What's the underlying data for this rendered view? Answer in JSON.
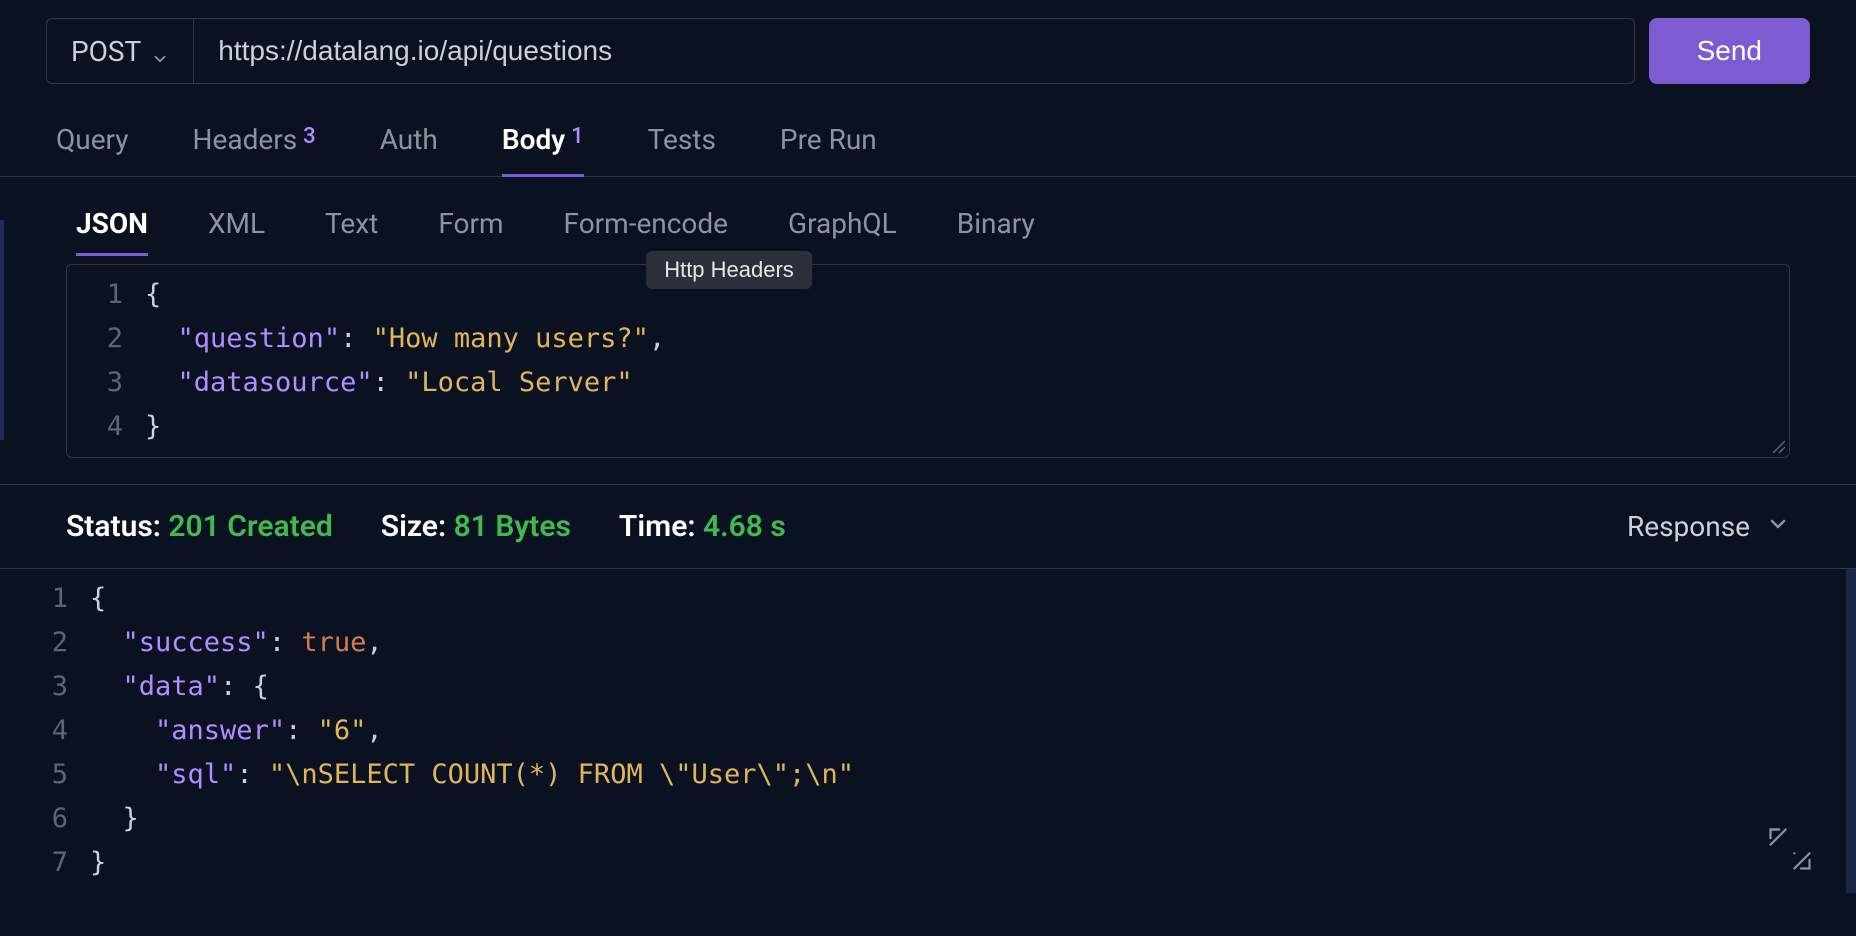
{
  "request": {
    "method": "POST",
    "url": "https://datalang.io/api/questions",
    "send_label": "Send"
  },
  "tabs": {
    "query": "Query",
    "headers": "Headers",
    "headers_badge": "3",
    "auth": "Auth",
    "body": "Body",
    "body_badge": "1",
    "tests": "Tests",
    "prerun": "Pre Run"
  },
  "subtabs": {
    "json": "JSON",
    "xml": "XML",
    "text": "Text",
    "form": "Form",
    "form_encode": "Form-encode",
    "graphql": "GraphQL",
    "binary": "Binary"
  },
  "tooltip": {
    "text": "Http Headers"
  },
  "request_body": {
    "line_numbers": [
      "1",
      "2",
      "3",
      "4"
    ],
    "lines": {
      "l1_punc": "{",
      "l2_key": "\"question\"",
      "l2_colon": ": ",
      "l2_val": "\"How many users?\"",
      "l2_comma": ",",
      "l3_key": "\"datasource\"",
      "l3_colon": ": ",
      "l3_val": "\"Local Server\"",
      "l4_punc": "}"
    }
  },
  "status": {
    "status_label": "Status: ",
    "status_value": "201 Created",
    "size_label": "Size: ",
    "size_value": "81 Bytes",
    "time_label": "Time: ",
    "time_value": "4.68 s",
    "response_label": "Response"
  },
  "response_body": {
    "line_numbers": [
      "1",
      "2",
      "3",
      "4",
      "5",
      "6",
      "7"
    ],
    "lines": {
      "l1": "{",
      "l2_key": "\"success\"",
      "l2_colon": ": ",
      "l2_val": "true",
      "l2_comma": ",",
      "l3_key": "\"data\"",
      "l3_colon": ": ",
      "l3_brace": "{",
      "l4_key": "\"answer\"",
      "l4_colon": ": ",
      "l4_val": "\"6\"",
      "l4_comma": ",",
      "l5_key": "\"sql\"",
      "l5_colon": ": ",
      "l5_val": "\"\\nSELECT COUNT(*) FROM \\\"User\\\";\\n\"",
      "l6": "}",
      "l7": "}"
    }
  }
}
